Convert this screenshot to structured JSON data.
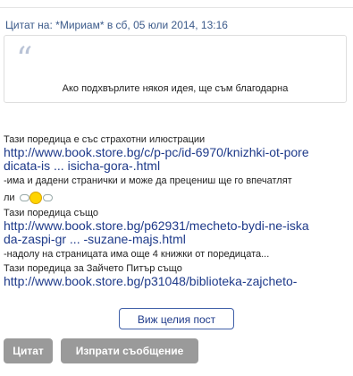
{
  "quote": {
    "header": "Цитат на: *Мириам* в сб, 05 юли 2014, 13:16",
    "text": "Ако подхвърлите някоя идея, ще съм благодарна"
  },
  "post": {
    "line1": "Тази поредица е със страхотни илюстрации",
    "link1a": "http://www.book.store.bg/c/p-pc/id-6970/knizhki-ot-pore",
    "link1b": "dicata-is ... isicha-gora-.html",
    "line2": "-има и дадени странички и може да прецениш ще го впечатлят",
    "line3": "ли",
    "smiley_icon": "clapping-smiley-icon",
    "line4": "Тази поредица също",
    "link2a": "http://www.book.store.bg/p62931/mecheto-bydi-ne-iska",
    "link2b": "da-zaspi-gr ... -suzane-majs.html",
    "line5": "-надолу на страницата има още 4 книжки от поредицата...",
    "line6": "Тази поредица за Зайчето Питър също",
    "link3a": "http://www.book.store.bg/p31048/biblioteka-zajcheto-"
  },
  "buttons": {
    "view_full": "Виж целия пост",
    "quote": "Цитат",
    "send_message": "Изпрати съобщение"
  }
}
